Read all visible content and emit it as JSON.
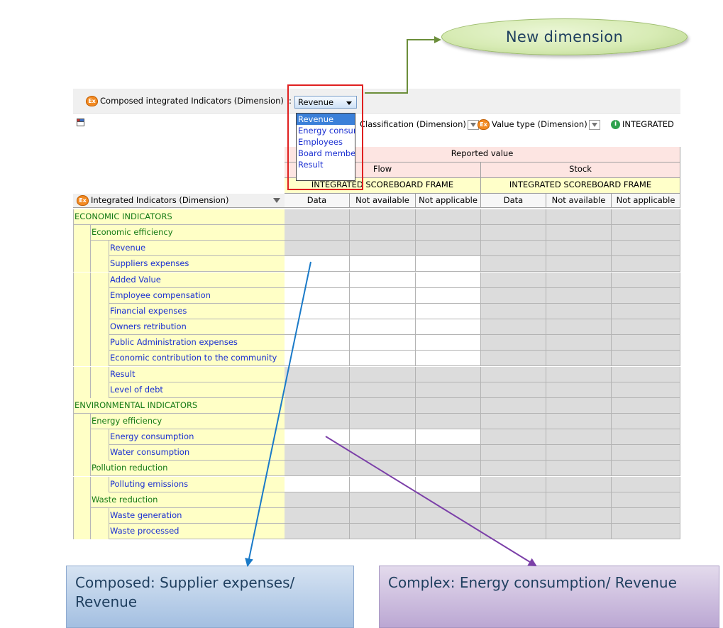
{
  "callout_top": "New dimension",
  "composed_dimension_label": "Composed integrated Indicators (Dimension)",
  "combo": {
    "separator": ":",
    "value": "Revenue"
  },
  "dropdown_options": [
    "Revenue",
    "Energy consumption",
    "Employees",
    "Board members",
    "Result"
  ],
  "toolbar": {
    "classification_label": "Classification (Dimension)",
    "value_type_label": "Value type (Dimension)",
    "integrated_label": "INTEGRATED"
  },
  "headers": {
    "reported_value": "Reported value",
    "flow": "Flow",
    "stock": "Stock",
    "frame_flow": "INTEGRATED SCOREBOARD FRAME",
    "frame_stock": "INTEGRATED SCOREBOARD FRAME",
    "columns": [
      "Data",
      "Not available",
      "Not applicable",
      "Data",
      "Not available",
      "Not applicable"
    ]
  },
  "row_dimension_label": "Integrated Indicators (Dimension)",
  "rows": [
    {
      "label": "ECONOMIC INDICATORS",
      "level": 0,
      "cells": "gggggg"
    },
    {
      "label": "Economic efficiency",
      "level": 1,
      "cells": "gggggg"
    },
    {
      "label": "Revenue",
      "level": 2,
      "cells": "gggggg"
    },
    {
      "label": "Suppliers expenses",
      "level": 2,
      "cells": "wwwggg"
    },
    {
      "label": "Added Value",
      "level": 2,
      "cells": "wwwggg"
    },
    {
      "label": "Employee compensation",
      "level": 2,
      "cells": "wwwggg"
    },
    {
      "label": "Financial expenses",
      "level": 2,
      "cells": "wwwggg"
    },
    {
      "label": "Owners retribution",
      "level": 2,
      "cells": "wwwggg"
    },
    {
      "label": "Public Administration expenses",
      "level": 2,
      "cells": "wwwggg"
    },
    {
      "label": "Economic contribution to the community",
      "level": 2,
      "cells": "wwwggg"
    },
    {
      "label": "Result",
      "level": 2,
      "cells": "gggggg"
    },
    {
      "label": "Level of debt",
      "level": 2,
      "cells": "gggggg"
    },
    {
      "label": "ENVIRONMENTAL INDICATORS",
      "level": 0,
      "cells": "gggggg"
    },
    {
      "label": "Energy efficiency",
      "level": 1,
      "cells": "gggggg"
    },
    {
      "label": "Energy consumption",
      "level": 2,
      "cells": "wwwggg"
    },
    {
      "label": "Water consumption",
      "level": 2,
      "cells": "gggggg"
    },
    {
      "label": "Pollution reduction",
      "level": 1,
      "cells": "gggggg"
    },
    {
      "label": "Polluting emissions",
      "level": 2,
      "cells": "wwwggg"
    },
    {
      "label": "Waste reduction",
      "level": 1,
      "cells": "gggggg"
    },
    {
      "label": "Waste generation",
      "level": 2,
      "cells": "gggggg"
    },
    {
      "label": "Waste processed",
      "level": 2,
      "cells": "gggggg"
    }
  ],
  "callout_left": "Composed: Supplier expenses/ Revenue",
  "callout_right": "Complex: Energy consumption/ Revenue",
  "colors": {
    "accent_red": "#e02020",
    "arrow_green": "#6b8e3a",
    "arrow_blue": "#1a7ac8",
    "arrow_purple": "#7b3fa8",
    "label_yellow": "#ffffc6"
  }
}
